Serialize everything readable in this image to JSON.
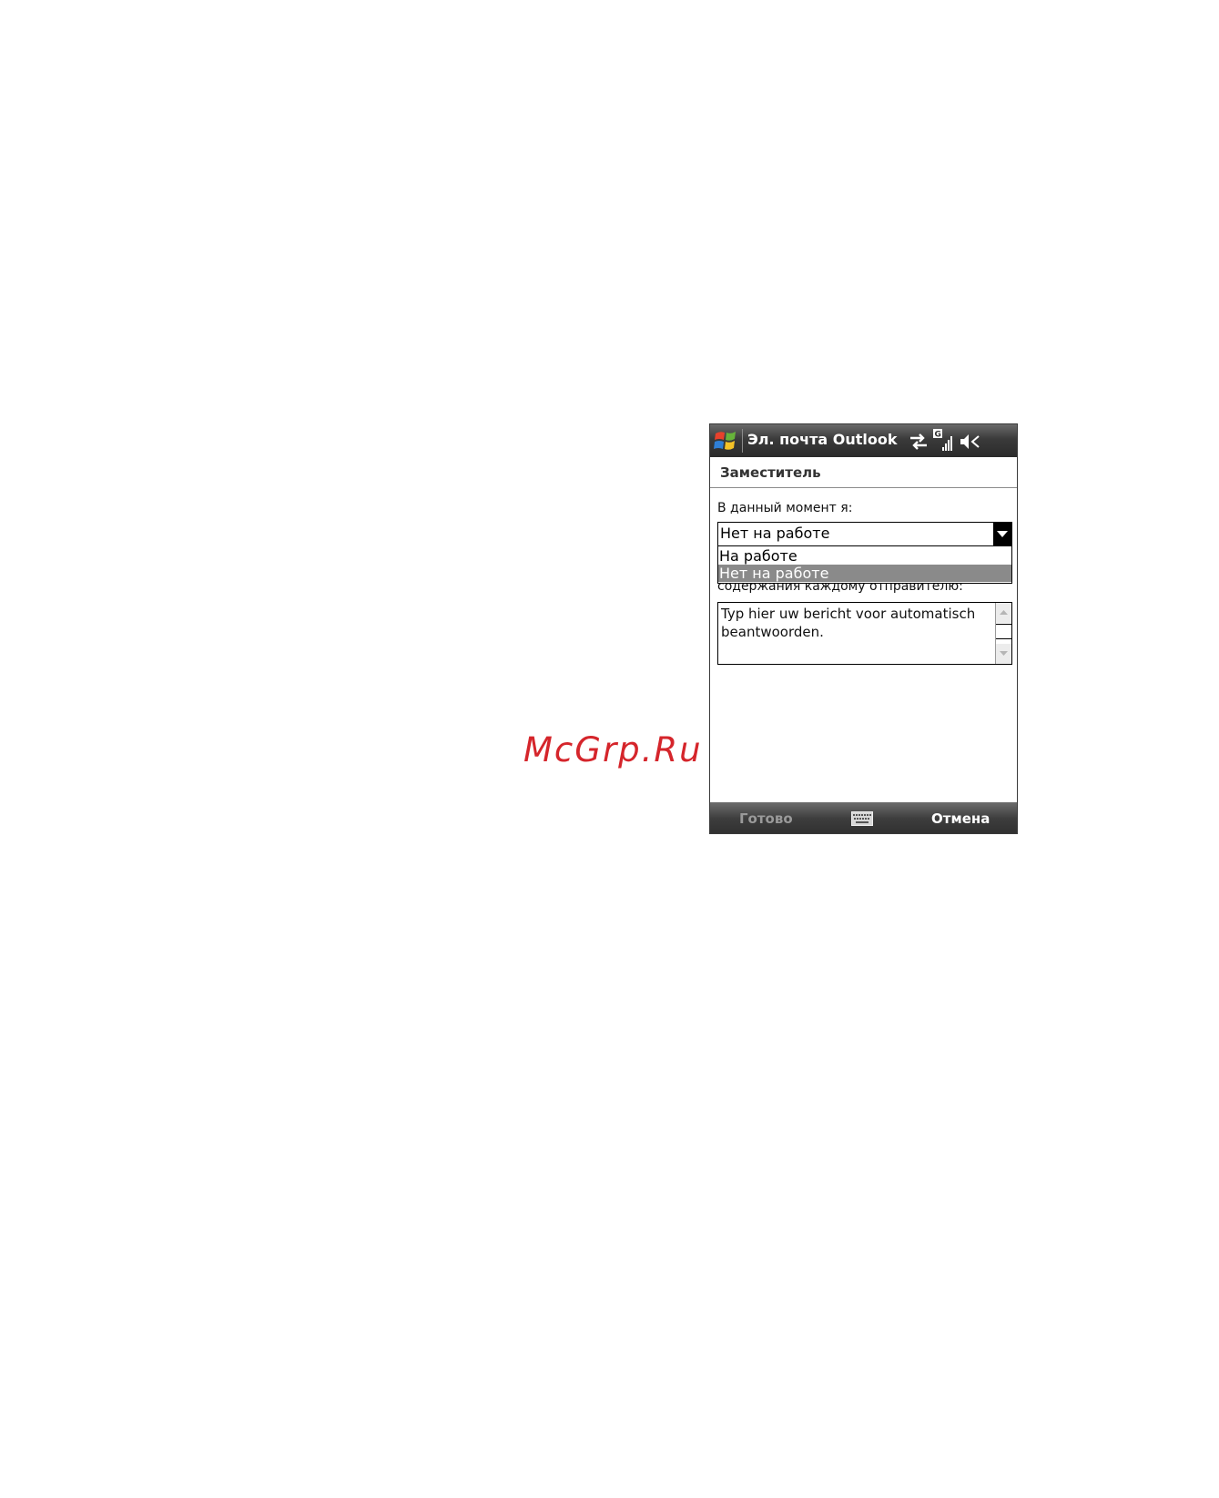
{
  "watermark": "McGrp.Ru",
  "titlebar": {
    "title": "Эл. почта Outlook",
    "icons": [
      "windows-start-icon",
      "data-sync-icon",
      "signal-gprs-icon",
      "volume-muted-icon"
    ]
  },
  "header": {
    "title": "Заместитель"
  },
  "form": {
    "status_label": "В данный момент я:",
    "status_value": "Нет на работе",
    "options": [
      "На работе",
      "Нет на работе"
    ],
    "hidden_label": "содержания каждому отправителю:",
    "message_text": "Typ hier uw bericht voor automatisch beantwoorden."
  },
  "softkeys": {
    "left": "Готово",
    "right": "Отмена",
    "middle_icon": "keyboard-icon"
  },
  "colors": {
    "watermark": "#d5252b",
    "bar_dark": "#2f2f2f",
    "selection": "#8a8a8a"
  }
}
